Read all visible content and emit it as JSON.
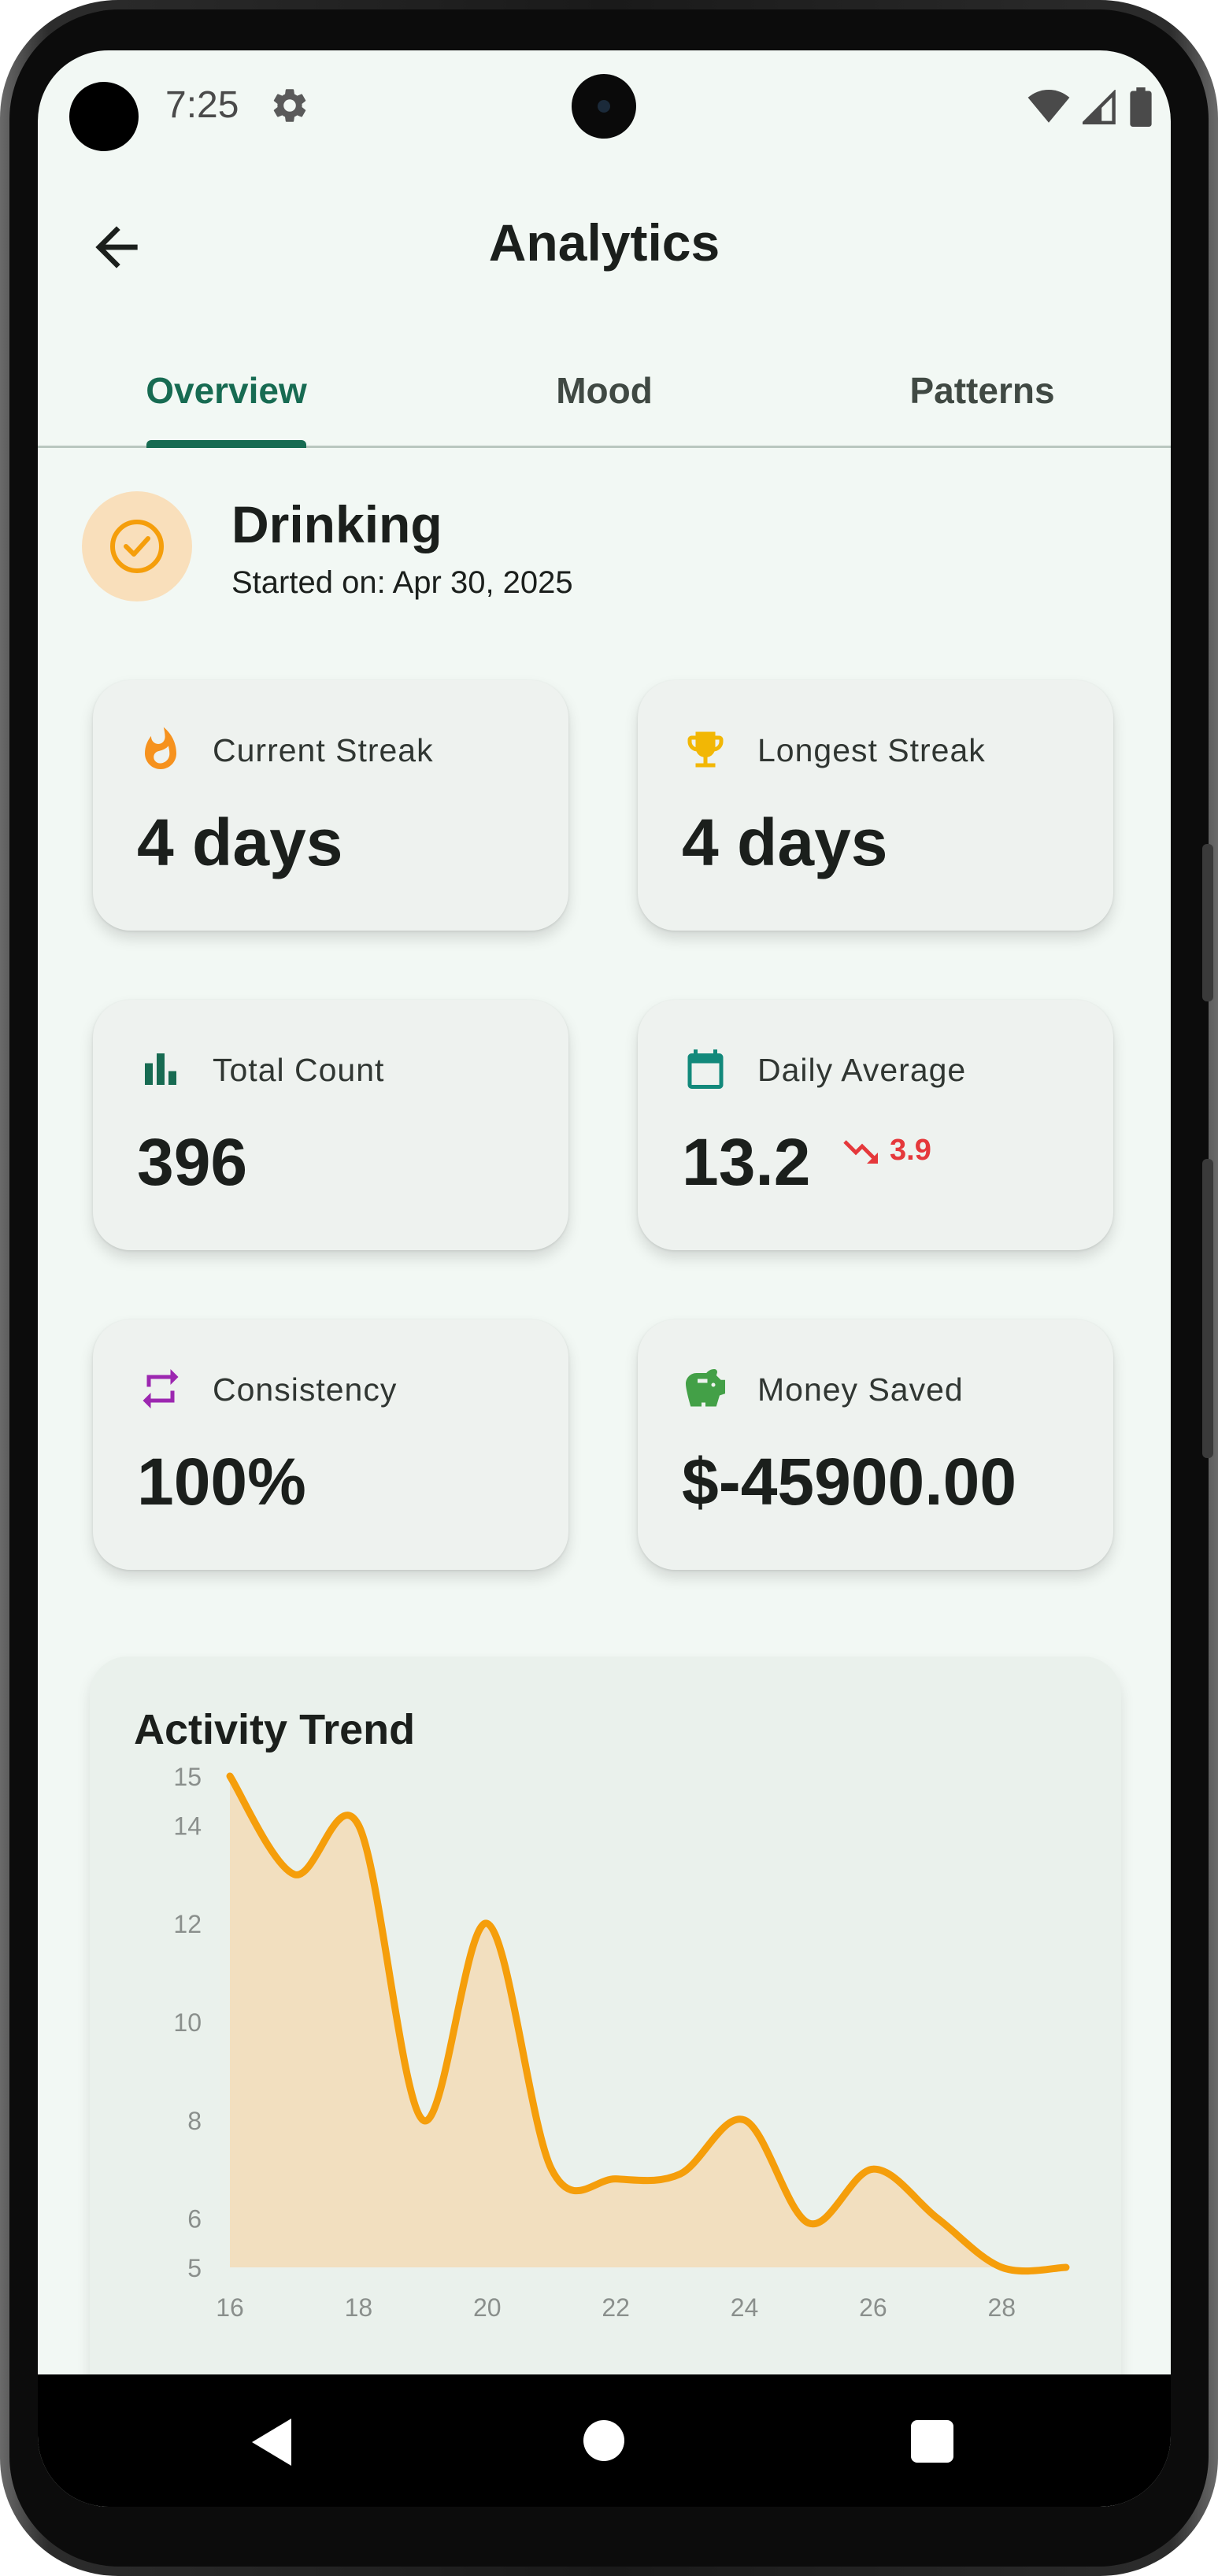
{
  "status_bar": {
    "time": "7:25",
    "icons": [
      "gear-icon",
      "wifi-icon",
      "signal-icon",
      "battery-icon"
    ]
  },
  "app_bar": {
    "title": "Analytics",
    "back_icon": "arrow-back-icon"
  },
  "tabs": [
    {
      "label": "Overview",
      "active": true
    },
    {
      "label": "Mood",
      "active": false
    },
    {
      "label": "Patterns",
      "active": false
    }
  ],
  "habit": {
    "name": "Drinking",
    "started": "Started on: Apr 30, 2025",
    "icon": "check-circle-icon"
  },
  "stats": [
    {
      "label": "Current Streak",
      "value": "4 days",
      "icon": "flame-icon",
      "icon_color": "#f6921e"
    },
    {
      "label": "Longest Streak",
      "value": "4 days",
      "icon": "trophy-icon",
      "icon_color": "#f2b705"
    },
    {
      "label": "Total Count",
      "value": "396",
      "icon": "bar-chart-icon",
      "icon_color": "#176b52"
    },
    {
      "label": "Daily Average",
      "value": "13.2",
      "trend": "3.9",
      "trend_direction": "down",
      "icon": "calendar-icon",
      "icon_color": "#12897b"
    },
    {
      "label": "Consistency",
      "value": "100%",
      "icon": "repeat-icon",
      "icon_color": "#9c27b0"
    },
    {
      "label": "Money Saved",
      "value": "$-45900.00",
      "icon": "piggy-bank-icon",
      "icon_color": "#43a047"
    }
  ],
  "chart_title": "Activity Trend",
  "chart_data": {
    "type": "area",
    "title": "Activity Trend",
    "x": [
      16,
      17,
      18,
      19,
      20,
      21,
      22,
      23,
      24,
      25,
      26,
      27,
      28,
      29
    ],
    "values": [
      15,
      13,
      14,
      8,
      12,
      7,
      6.8,
      6.9,
      8,
      5.9,
      7,
      6,
      5,
      5
    ],
    "xticks": [
      "16",
      "18",
      "20",
      "22",
      "24",
      "26",
      "28"
    ],
    "yticks": [
      "5",
      "6",
      "8",
      "10",
      "12",
      "14",
      "15"
    ],
    "xlim": [
      16,
      29
    ],
    "ylim": [
      5,
      15
    ],
    "line_color": "#f59e0b",
    "fill_color": "#f2dfbf",
    "grid": false
  },
  "nav_bar": {
    "buttons": [
      "back-nav-icon",
      "home-nav-icon",
      "recents-nav-icon"
    ]
  }
}
